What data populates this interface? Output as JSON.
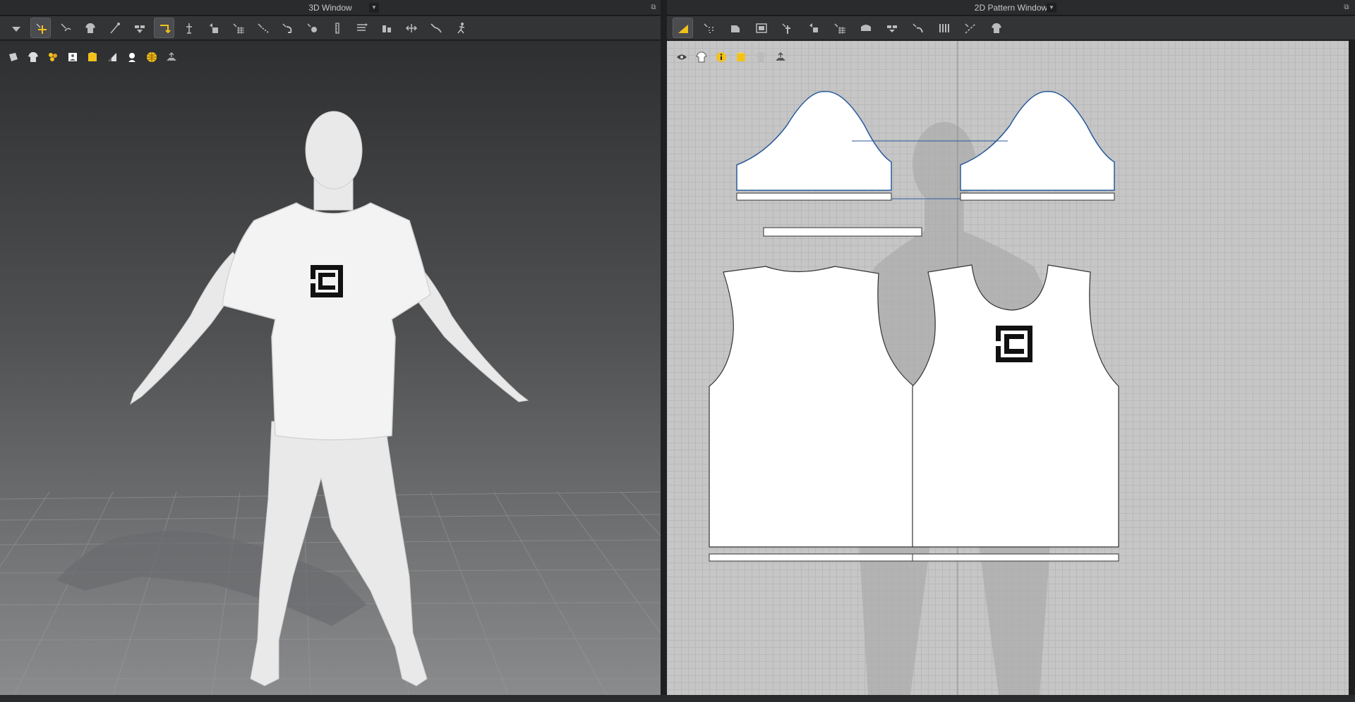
{
  "windows": {
    "left": {
      "title": "3D Window"
    },
    "right": {
      "title": "2D Pattern Window"
    }
  },
  "toolbar_3d": {
    "icons": [
      "select-mesh-icon",
      "transform-pattern-icon",
      "fold-arrangement-icon",
      "garment-icon",
      "pin-icon",
      "tack-icon",
      "fold-icon",
      "move-pattern-icon",
      "arrange-icon",
      "seam-line-icon",
      "arrangement-plane-icon",
      "tape-icon",
      "point-icon",
      "measure-icon",
      "avatar-size-icon",
      "circumference-icon",
      "puckering-icon",
      "strengthen-icon",
      "stretch-icon",
      "pose-icon"
    ]
  },
  "toolbar_2d": {
    "icons": [
      "edit-pattern-icon",
      "transform-2d-icon",
      "trim-icon",
      "polygon-icon",
      "internal-line-icon",
      "dart-icon",
      "grid-icon",
      "seam-allowance-icon",
      "fold-2d-icon",
      "segment-sewing-icon",
      "pleat-icon",
      "sewing-check-icon",
      "garment-2d-icon"
    ]
  },
  "subtoolbar_3d": {
    "icons": [
      "show-avatar-icon",
      "show-garment-icon",
      "show-texture-icon",
      "show-avatar-body-icon",
      "render-mode-icon",
      "shading-icon",
      "avatar-surface-icon",
      "environment-map-icon",
      "floor-icon"
    ]
  },
  "subtoolbar_2d": {
    "icons": [
      "visibility-eye-icon",
      "show-garment-2d-icon",
      "info-icon",
      "texture-2d-icon",
      "show-avatar-2d-icon",
      "grid-floor-icon"
    ]
  },
  "colors": {
    "accent": "#f2c21b",
    "panel": "#333436",
    "pattern_bg": "#c6c6c6"
  }
}
